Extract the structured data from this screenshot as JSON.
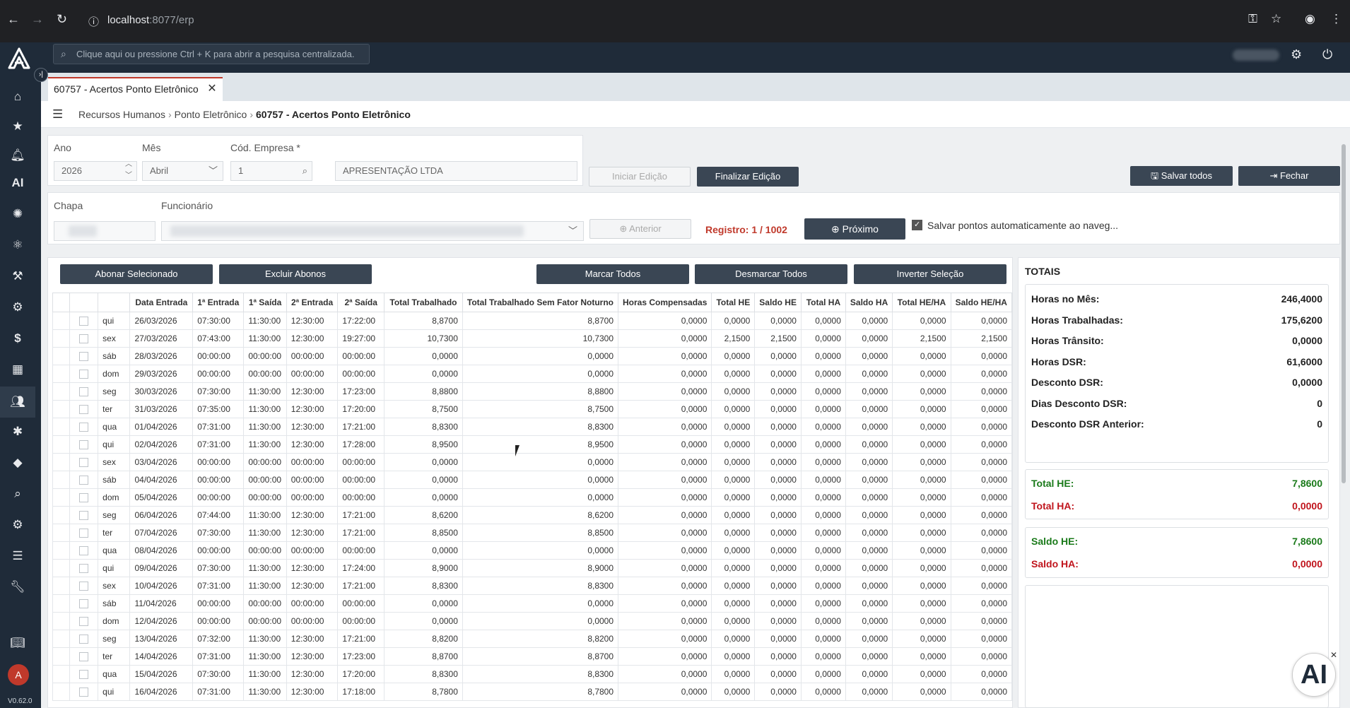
{
  "browser": {
    "url_host": "localhost",
    "url_rest": ":8077/erp"
  },
  "app": {
    "search_placeholder": "Clique aqui ou pressione Ctrl + K para abrir a pesquisa centralizada.",
    "version": "V0.62.0",
    "avatar_letter": "A",
    "ai_label": "AI",
    "ai_bubble_label": "AI"
  },
  "tab": {
    "title": "60757 - Acertos Ponto Eletrônico",
    "close": "✕"
  },
  "breadcrumb": {
    "items": [
      "Recursos Humanos",
      "Ponto Eletrônico"
    ],
    "current": "60757 - Acertos Ponto Eletrônico",
    "separator": "›"
  },
  "filters": {
    "ano_label": "Ano",
    "ano_value": "2026",
    "mes_label": "Mês",
    "mes_value": "Abril",
    "empresa_label": "Cód. Empresa *",
    "empresa_code": "1",
    "empresa_name": "APRESENTAÇÃO LTDA",
    "chapa_label": "Chapa",
    "funcionario_label": "Funcionário"
  },
  "actions": {
    "iniciar_edicao": "Iniciar Edição",
    "finalizar_edicao": "Finalizar Edição",
    "salvar_todos": "Salvar todos",
    "fechar": "Fechar",
    "anterior": "Anterior",
    "proximo": "Próximo",
    "registro": "Registro: 1 / 1002",
    "auto_save": "Salvar pontos automaticamente ao naveg...",
    "abonar": "Abonar Selecionado",
    "excluir_abonos": "Excluir Abonos",
    "marcar_todos": "Marcar Todos",
    "desmarcar_todos": "Desmarcar Todos",
    "inverter_selecao": "Inverter Seleção"
  },
  "table": {
    "columns": [
      "Data Entrada",
      "1ª Entrada",
      "1ª Saída",
      "2ª Entrada",
      "2ª Saída",
      "Total Trabalhado",
      "Total Trabalhado Sem Fator Noturno",
      "Horas Compensadas",
      "Total HE",
      "Saldo HE",
      "Total HA",
      "Saldo HA",
      "Total HE/HA",
      "Saldo HE/HA"
    ],
    "rows": [
      [
        "qui",
        "26/03/2026",
        "07:30:00",
        "11:30:00",
        "12:30:00",
        "17:22:00",
        "8,8700",
        "8,8700",
        "0,0000",
        "0,0000",
        "0,0000",
        "0,0000",
        "0,0000",
        "0,0000",
        "0,0000"
      ],
      [
        "sex",
        "27/03/2026",
        "07:43:00",
        "11:30:00",
        "12:30:00",
        "19:27:00",
        "10,7300",
        "10,7300",
        "0,0000",
        "2,1500",
        "2,1500",
        "0,0000",
        "0,0000",
        "2,1500",
        "2,1500"
      ],
      [
        "sáb",
        "28/03/2026",
        "00:00:00",
        "00:00:00",
        "00:00:00",
        "00:00:00",
        "0,0000",
        "0,0000",
        "0,0000",
        "0,0000",
        "0,0000",
        "0,0000",
        "0,0000",
        "0,0000",
        "0,0000"
      ],
      [
        "dom",
        "29/03/2026",
        "00:00:00",
        "00:00:00",
        "00:00:00",
        "00:00:00",
        "0,0000",
        "0,0000",
        "0,0000",
        "0,0000",
        "0,0000",
        "0,0000",
        "0,0000",
        "0,0000",
        "0,0000"
      ],
      [
        "seg",
        "30/03/2026",
        "07:30:00",
        "11:30:00",
        "12:30:00",
        "17:23:00",
        "8,8800",
        "8,8800",
        "0,0000",
        "0,0000",
        "0,0000",
        "0,0000",
        "0,0000",
        "0,0000",
        "0,0000"
      ],
      [
        "ter",
        "31/03/2026",
        "07:35:00",
        "11:30:00",
        "12:30:00",
        "17:20:00",
        "8,7500",
        "8,7500",
        "0,0000",
        "0,0000",
        "0,0000",
        "0,0000",
        "0,0000",
        "0,0000",
        "0,0000"
      ],
      [
        "qua",
        "01/04/2026",
        "07:31:00",
        "11:30:00",
        "12:30:00",
        "17:21:00",
        "8,8300",
        "8,8300",
        "0,0000",
        "0,0000",
        "0,0000",
        "0,0000",
        "0,0000",
        "0,0000",
        "0,0000"
      ],
      [
        "qui",
        "02/04/2026",
        "07:31:00",
        "11:30:00",
        "12:30:00",
        "17:28:00",
        "8,9500",
        "8,9500",
        "0,0000",
        "0,0000",
        "0,0000",
        "0,0000",
        "0,0000",
        "0,0000",
        "0,0000"
      ],
      [
        "sex",
        "03/04/2026",
        "00:00:00",
        "00:00:00",
        "00:00:00",
        "00:00:00",
        "0,0000",
        "0,0000",
        "0,0000",
        "0,0000",
        "0,0000",
        "0,0000",
        "0,0000",
        "0,0000",
        "0,0000"
      ],
      [
        "sáb",
        "04/04/2026",
        "00:00:00",
        "00:00:00",
        "00:00:00",
        "00:00:00",
        "0,0000",
        "0,0000",
        "0,0000",
        "0,0000",
        "0,0000",
        "0,0000",
        "0,0000",
        "0,0000",
        "0,0000"
      ],
      [
        "dom",
        "05/04/2026",
        "00:00:00",
        "00:00:00",
        "00:00:00",
        "00:00:00",
        "0,0000",
        "0,0000",
        "0,0000",
        "0,0000",
        "0,0000",
        "0,0000",
        "0,0000",
        "0,0000",
        "0,0000"
      ],
      [
        "seg",
        "06/04/2026",
        "07:44:00",
        "11:30:00",
        "12:30:00",
        "17:21:00",
        "8,6200",
        "8,6200",
        "0,0000",
        "0,0000",
        "0,0000",
        "0,0000",
        "0,0000",
        "0,0000",
        "0,0000"
      ],
      [
        "ter",
        "07/04/2026",
        "07:30:00",
        "11:30:00",
        "12:30:00",
        "17:21:00",
        "8,8500",
        "8,8500",
        "0,0000",
        "0,0000",
        "0,0000",
        "0,0000",
        "0,0000",
        "0,0000",
        "0,0000"
      ],
      [
        "qua",
        "08/04/2026",
        "00:00:00",
        "00:00:00",
        "00:00:00",
        "00:00:00",
        "0,0000",
        "0,0000",
        "0,0000",
        "0,0000",
        "0,0000",
        "0,0000",
        "0,0000",
        "0,0000",
        "0,0000"
      ],
      [
        "qui",
        "09/04/2026",
        "07:30:00",
        "11:30:00",
        "12:30:00",
        "17:24:00",
        "8,9000",
        "8,9000",
        "0,0000",
        "0,0000",
        "0,0000",
        "0,0000",
        "0,0000",
        "0,0000",
        "0,0000"
      ],
      [
        "sex",
        "10/04/2026",
        "07:31:00",
        "11:30:00",
        "12:30:00",
        "17:21:00",
        "8,8300",
        "8,8300",
        "0,0000",
        "0,0000",
        "0,0000",
        "0,0000",
        "0,0000",
        "0,0000",
        "0,0000"
      ],
      [
        "sáb",
        "11/04/2026",
        "00:00:00",
        "00:00:00",
        "00:00:00",
        "00:00:00",
        "0,0000",
        "0,0000",
        "0,0000",
        "0,0000",
        "0,0000",
        "0,0000",
        "0,0000",
        "0,0000",
        "0,0000"
      ],
      [
        "dom",
        "12/04/2026",
        "00:00:00",
        "00:00:00",
        "00:00:00",
        "00:00:00",
        "0,0000",
        "0,0000",
        "0,0000",
        "0,0000",
        "0,0000",
        "0,0000",
        "0,0000",
        "0,0000",
        "0,0000"
      ],
      [
        "seg",
        "13/04/2026",
        "07:32:00",
        "11:30:00",
        "12:30:00",
        "17:21:00",
        "8,8200",
        "8,8200",
        "0,0000",
        "0,0000",
        "0,0000",
        "0,0000",
        "0,0000",
        "0,0000",
        "0,0000"
      ],
      [
        "ter",
        "14/04/2026",
        "07:31:00",
        "11:30:00",
        "12:30:00",
        "17:23:00",
        "8,8700",
        "8,8700",
        "0,0000",
        "0,0000",
        "0,0000",
        "0,0000",
        "0,0000",
        "0,0000",
        "0,0000"
      ],
      [
        "qua",
        "15/04/2026",
        "07:30:00",
        "11:30:00",
        "12:30:00",
        "17:20:00",
        "8,8300",
        "8,8300",
        "0,0000",
        "0,0000",
        "0,0000",
        "0,0000",
        "0,0000",
        "0,0000",
        "0,0000"
      ],
      [
        "qui",
        "16/04/2026",
        "07:31:00",
        "11:30:00",
        "12:30:00",
        "17:18:00",
        "8,7800",
        "8,7800",
        "0,0000",
        "0,0000",
        "0,0000",
        "0,0000",
        "0,0000",
        "0,0000",
        "0,0000"
      ]
    ]
  },
  "totals": {
    "title": "TOTAIS",
    "horas": [
      {
        "label": "Horas no Mês:",
        "value": "246,4000"
      },
      {
        "label": "Horas Trabalhadas:",
        "value": "175,6200"
      },
      {
        "label": "Horas Trânsito:",
        "value": "0,0000"
      },
      {
        "label": "Horas DSR:",
        "value": "61,6000"
      },
      {
        "label": "Desconto DSR:",
        "value": "0,0000"
      },
      {
        "label": "Dias Desconto DSR:",
        "value": "0"
      },
      {
        "label": "Desconto DSR Anterior:",
        "value": "0"
      }
    ],
    "total_he_label": "Total HE:",
    "total_he": "7,8600",
    "total_ha_label": "Total HA:",
    "total_ha": "0,0000",
    "saldo_he_label": "Saldo HE:",
    "saldo_he": "7,8600",
    "saldo_ha_label": "Saldo HA:",
    "saldo_ha": "0,0000"
  },
  "colors": {
    "accent_red": "#c0392b",
    "nav_dark": "#1f2b39",
    "positive_green": "#1a7a1a",
    "negative_red": "#c0141c"
  }
}
